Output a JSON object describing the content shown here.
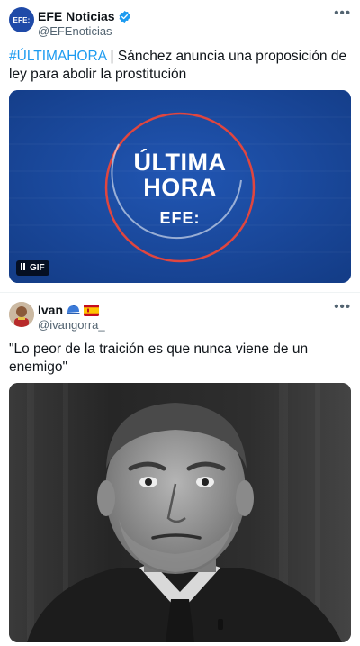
{
  "tweets": [
    {
      "avatar_text": "EFE:",
      "name": "EFE Noticias",
      "verified": true,
      "handle": "@EFEnoticias",
      "more_label": "•••",
      "hashtag": "#ÚLTIMAHORA",
      "body": " | Sánchez anuncia una proposición de ley para abolir la prostitución",
      "media": {
        "type": "gif",
        "line1": "ÚLTIMA",
        "line2": "HORA",
        "brand": "EFE:",
        "badge": "GIF"
      }
    },
    {
      "name": "Ivan",
      "name_emojis": [
        "blue-cap",
        "spain-flag"
      ],
      "handle": "@ivangorra_",
      "more_label": "•••",
      "body": "\"Lo peor de la traición es que nunca viene de un enemigo\"",
      "media": {
        "type": "photo"
      }
    }
  ],
  "colors": {
    "link": "#1d9bf0",
    "verified": "#1d9bf0",
    "efe_blue": "#19489d",
    "efe_ring": "#e0463f",
    "handle_gray": "#536471"
  }
}
